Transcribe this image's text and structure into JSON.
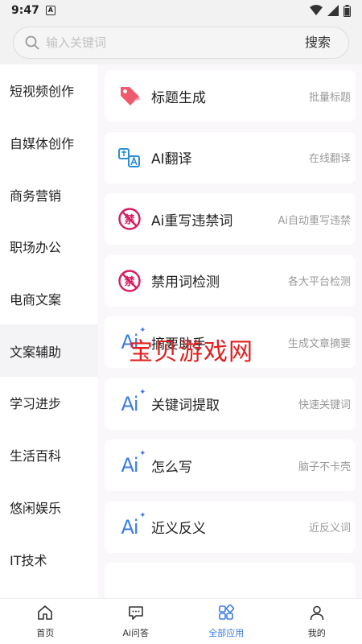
{
  "status": {
    "time": "9:47",
    "badge": "A"
  },
  "search": {
    "placeholder": "输入关键词",
    "button": "搜索"
  },
  "categories": [
    {
      "label": "短视频创作"
    },
    {
      "label": "自媒体创作"
    },
    {
      "label": "商务营销"
    },
    {
      "label": "职场办公"
    },
    {
      "label": "电商文案"
    },
    {
      "label": "文案辅助",
      "active": true
    },
    {
      "label": "学习进步"
    },
    {
      "label": "生活百科"
    },
    {
      "label": "悠闲娱乐"
    },
    {
      "label": "IT技术"
    }
  ],
  "tools": [
    {
      "title": "标题生成",
      "desc": "批量标题",
      "icon": "tag-icon"
    },
    {
      "title": "AI翻译",
      "desc": "在线翻译",
      "icon": "translate-icon"
    },
    {
      "title": "Ai重写违禁词",
      "desc": "Ai自动重写违禁",
      "icon": "forbidden-icon"
    },
    {
      "title": "禁用词检测",
      "desc": "各大平台检测",
      "icon": "forbidden-icon"
    },
    {
      "title": "摘要助手",
      "desc": "生成文章摘要",
      "icon": "ai-icon"
    },
    {
      "title": "关键词提取",
      "desc": "快速关键词",
      "icon": "ai-icon"
    },
    {
      "title": "怎么写",
      "desc": "脑子不卡壳",
      "icon": "ai-icon"
    },
    {
      "title": "近义反义",
      "desc": "近反义词",
      "icon": "ai-icon"
    }
  ],
  "watermark": "宝贝游戏网",
  "icons": {
    "ai_glyph": "Ai",
    "forbidden_glyph": "禁"
  },
  "nav": [
    {
      "label": "首页",
      "icon": "home-icon"
    },
    {
      "label": "Ai问答",
      "icon": "chat-icon"
    },
    {
      "label": "全部应用",
      "icon": "apps-icon",
      "active": true
    },
    {
      "label": "我的",
      "icon": "profile-icon"
    }
  ],
  "colors": {
    "accent": "#3b7be8",
    "tag": "#f05a6e",
    "forbidden": "#d81b60"
  }
}
